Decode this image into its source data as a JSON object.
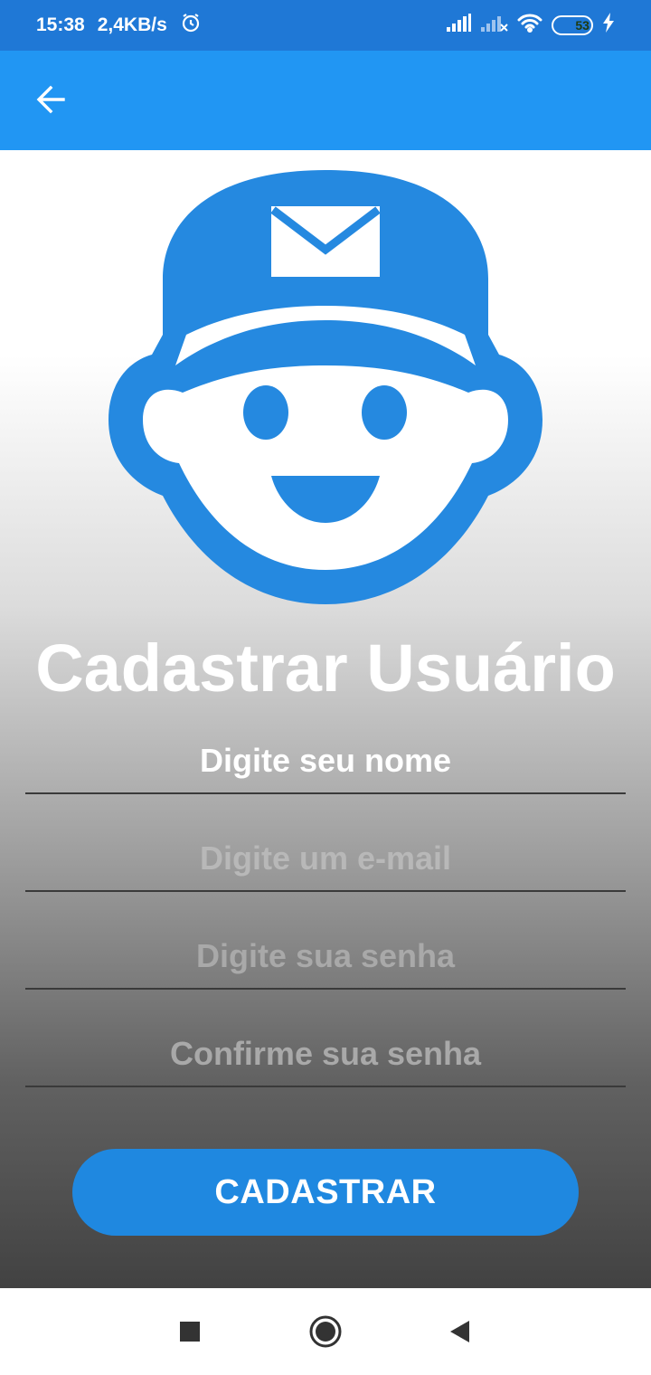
{
  "status_bar": {
    "time": "15:38",
    "speed": "2,4KB/s",
    "battery": "53",
    "icons": [
      "alarm-icon",
      "signal-icon",
      "signal-off-icon",
      "wifi-icon",
      "battery-icon",
      "charging-icon"
    ]
  },
  "app_bar": {
    "back_icon": "arrow-left-icon"
  },
  "logo": {
    "icon": "mail-carrier-face-icon",
    "color": "#2589e0"
  },
  "title": "Cadastrar Usuário",
  "form": {
    "name_placeholder": "Digite seu nome",
    "email_placeholder": "Digite um e-mail",
    "password_placeholder": "Digite sua senha",
    "confirm_placeholder": "Confirme sua senha",
    "submit_label": "CADASTRAR"
  },
  "nav_bar": {
    "icons": [
      "recents-square-icon",
      "home-circle-icon",
      "back-triangle-icon"
    ]
  },
  "colors": {
    "app_bar": "#2196f3",
    "status_bar": "#1f78d6",
    "button": "#1f88e0"
  }
}
